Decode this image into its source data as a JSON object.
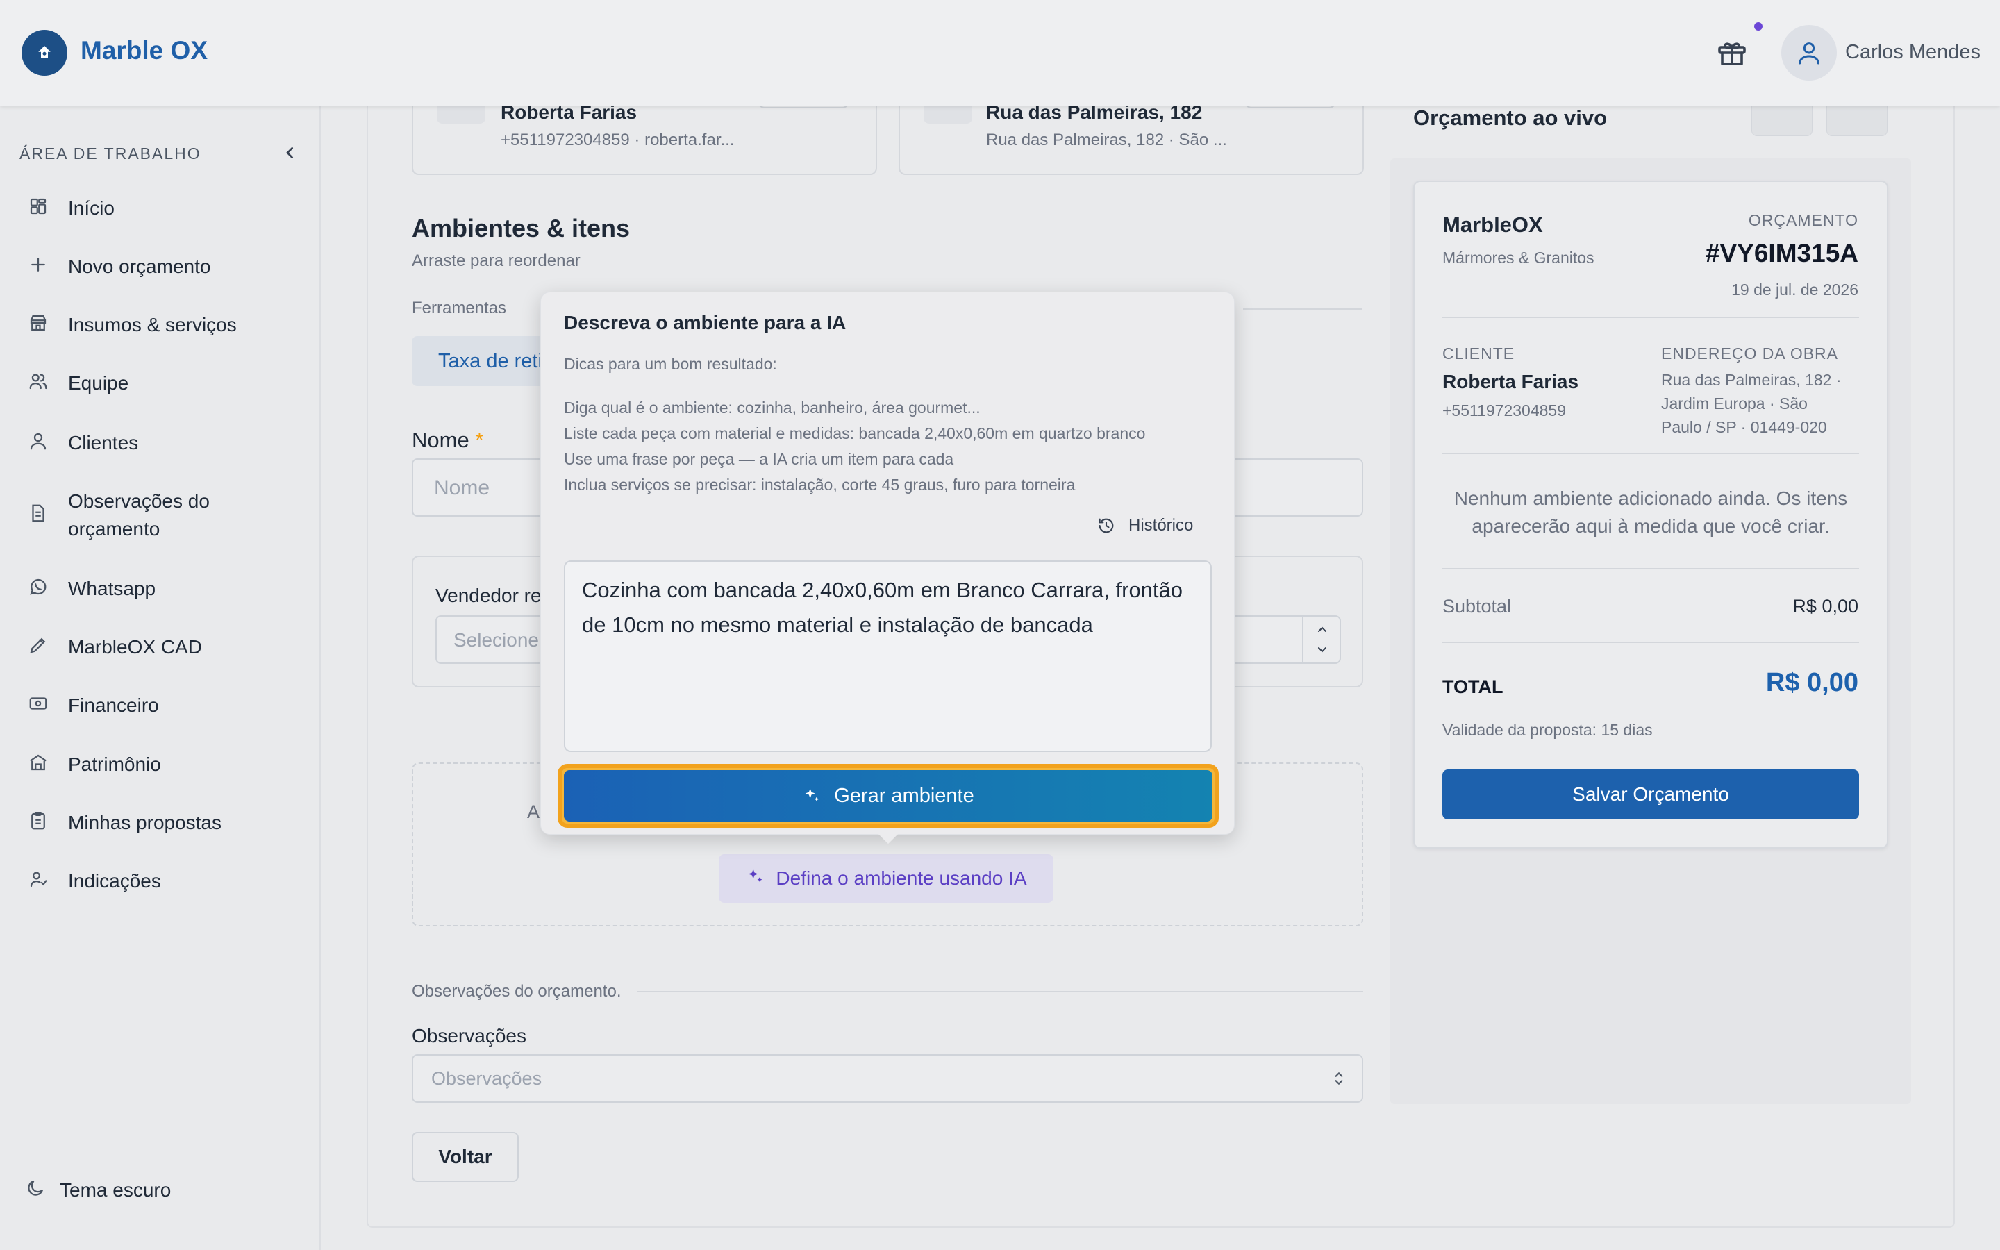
{
  "header": {
    "brand": "Marble OX",
    "user_name": "Carlos Mendes"
  },
  "sidebar": {
    "heading": "ÁREA DE TRABALHO",
    "items": [
      {
        "label": "Início",
        "icon": "dashboard-icon"
      },
      {
        "label": "Novo orçamento",
        "icon": "plus-icon"
      },
      {
        "label": "Insumos & serviços",
        "icon": "store-icon"
      },
      {
        "label": "Equipe",
        "icon": "users-icon"
      },
      {
        "label": "Clientes",
        "icon": "user-icon"
      },
      {
        "label": "Observações do orçamento",
        "icon": "document-icon"
      },
      {
        "label": "Whatsapp",
        "icon": "whatsapp-icon"
      },
      {
        "label": "MarbleOX CAD",
        "icon": "pencil-icon"
      },
      {
        "label": "Financeiro",
        "icon": "money-icon"
      },
      {
        "label": "Patrimônio",
        "icon": "building-icon"
      },
      {
        "label": "Minhas propostas",
        "icon": "clipboard-icon"
      },
      {
        "label": "Indicações",
        "icon": "user-referral-icon"
      }
    ],
    "theme_toggle": "Tema escuro"
  },
  "client_card": {
    "name": "Roberta Farias",
    "details": "+5511972304859 · roberta.far..."
  },
  "address_card": {
    "title": "Rua das Palmeiras, 182",
    "details": "Rua das Palmeiras, 182 · São ..."
  },
  "environments": {
    "title": "Ambientes & itens",
    "subtitle": "Arraste para reordenar",
    "tools_label": "Ferramentas",
    "tool_button": "Taxa de reti",
    "name_label": "Nome",
    "required_mark": "*",
    "name_placeholder": "Nome",
    "seller_label": "Vendedor re",
    "seller_placeholder": "Selecione",
    "empty_prefix": "A",
    "ai_button": "Defina o ambiente usando IA"
  },
  "observations": {
    "section_label": "Observações do orçamento.",
    "field_label": "Observações",
    "placeholder": "Observações",
    "back_button": "Voltar"
  },
  "ai_popover": {
    "title": "Descreva o ambiente para a IA",
    "tips_heading": "Dicas para um bom resultado:",
    "tips": [
      "Diga qual é o ambiente: cozinha, banheiro, área gourmet...",
      "Liste cada peça com material e medidas: bancada 2,40x0,60m em quartzo branco",
      "Use uma frase por peça — a IA cria um item para cada",
      "Inclua serviços se precisar: instalação, corte 45 graus, furo para torneira"
    ],
    "history_button": "Histórico",
    "textarea_value": "Cozinha com bancada 2,40x0,60m em Branco Carrara, frontão de 10cm no mesmo material e instalação de bancada",
    "generate_button": "Gerar ambiente"
  },
  "quote": {
    "panel_title": "Orçamento ao vivo",
    "company": "MarbleOX",
    "company_sub": "Mármores & Granitos",
    "doc_label": "ORÇAMENTO",
    "number": "#VY6IM315A",
    "date": "19 de jul. de 2026",
    "client_label": "CLIENTE",
    "client_name": "Roberta Farias",
    "client_phone": "+5511972304859",
    "address_label": "ENDEREÇO DA OBRA",
    "address_lines": [
      "Rua das Palmeiras, 182 ·",
      "Jardim Europa · São",
      "Paulo / SP · 01449-020"
    ],
    "empty_message": "Nenhum ambiente adicionado ainda. Os itens aparecerão aqui à medida que você criar.",
    "subtotal_label": "Subtotal",
    "subtotal_value": "R$ 0,00",
    "total_label": "TOTAL",
    "total_value": "R$ 0,00",
    "validity": "Validade da proposta: 15 dias",
    "save_button": "Salvar Orçamento"
  },
  "colors": {
    "brand": "#1f5fa8",
    "accent_blue": "#1d61ad",
    "highlight_orange": "#f2a21d",
    "ai_purple": "#6b46d6",
    "required_orange": "#f59e0b"
  }
}
